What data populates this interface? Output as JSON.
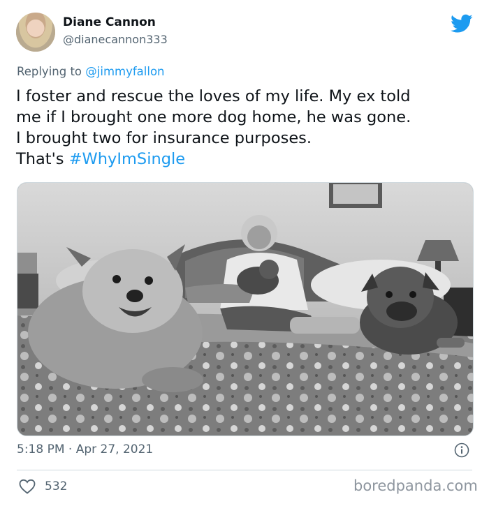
{
  "tweet": {
    "author_name": "Diane Cannon",
    "author_handle": "@dianecannon333",
    "replying_prefix": "Replying to",
    "replying_to": "@jimmyfallon",
    "text_lines": [
      "I foster and rescue the loves of my life. My ex told",
      "me if I brought one more dog home, he was gone.",
      "I brought two for insurance purposes."
    ],
    "last_line_prefix": "That's",
    "hashtag": "#WhyImSingle",
    "timestamp": "5:18 PM · Apr 27, 2021",
    "like_count": "532"
  },
  "icons": {
    "avatar": "avatar-photo",
    "brand": "twitter-bird-icon",
    "info": "info-icon",
    "like": "heart-icon"
  },
  "colors": {
    "accent": "#1d9bf0",
    "secondary_text": "#536471",
    "primary_text": "#0f1419",
    "watermark": "#8d959e"
  },
  "watermark": "boredpanda.com"
}
